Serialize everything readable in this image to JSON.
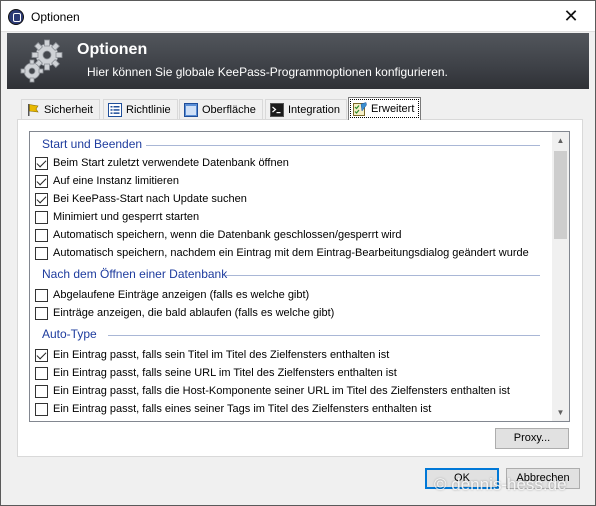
{
  "window": {
    "title": "Optionen",
    "close_glyph": "✕"
  },
  "banner": {
    "title": "Optionen",
    "subtitle": "Hier können Sie globale KeePass-Programmoptionen konfigurieren.",
    "icon": "gears-icon"
  },
  "tabs": [
    {
      "label": "Sicherheit",
      "icon": "flag-icon"
    },
    {
      "label": "Richtlinie",
      "icon": "list-icon"
    },
    {
      "label": "Oberfläche",
      "icon": "window-icon"
    },
    {
      "label": "Integration",
      "icon": "terminal-icon"
    },
    {
      "label": "Erweitert",
      "icon": "checklist-icon",
      "active": true
    }
  ],
  "groups": [
    {
      "header": "Start und Beenden",
      "items": [
        {
          "label": "Beim Start zuletzt verwendete Datenbank öffnen",
          "checked": true
        },
        {
          "label": "Auf eine Instanz limitieren",
          "checked": true
        },
        {
          "label": "Bei KeePass-Start nach Update suchen",
          "checked": true
        },
        {
          "label": "Minimiert und gesperrt starten",
          "checked": false
        },
        {
          "label": "Automatisch speichern, wenn die Datenbank geschlossen/gesperrt wird",
          "checked": false
        },
        {
          "label": "Automatisch speichern, nachdem ein Eintrag mit dem Eintrag-Bearbeitungsdialog geändert wurde",
          "checked": false
        }
      ]
    },
    {
      "header": "Nach dem Öffnen einer Datenbank",
      "items": [
        {
          "label": "Abgelaufene Einträge anzeigen (falls es welche gibt)",
          "checked": false
        },
        {
          "label": "Einträge anzeigen, die bald ablaufen (falls es welche gibt)",
          "checked": false
        }
      ]
    },
    {
      "header": "Auto-Type",
      "items": [
        {
          "label": "Ein Eintrag passt, falls sein Titel im Titel des Zielfensters enthalten ist",
          "checked": true
        },
        {
          "label": "Ein Eintrag passt, falls seine URL im Titel des Zielfensters enthalten ist",
          "checked": false
        },
        {
          "label": "Ein Eintrag passt, falls die Host-Komponente seiner URL im Titel des Zielfensters enthalten ist",
          "checked": false
        },
        {
          "label": "Ein Eintrag passt, falls eines seiner Tags im Titel des Zielfensters enthalten ist",
          "checked": false
        }
      ]
    }
  ],
  "buttons": {
    "proxy": "Proxy...",
    "ok": "OK",
    "cancel": "Abbrechen"
  },
  "watermark": "© dennis-hess.de",
  "colors": {
    "group_header": "#1e3c9e",
    "banner": "#3e4147",
    "ok_border": "#0078d7"
  }
}
